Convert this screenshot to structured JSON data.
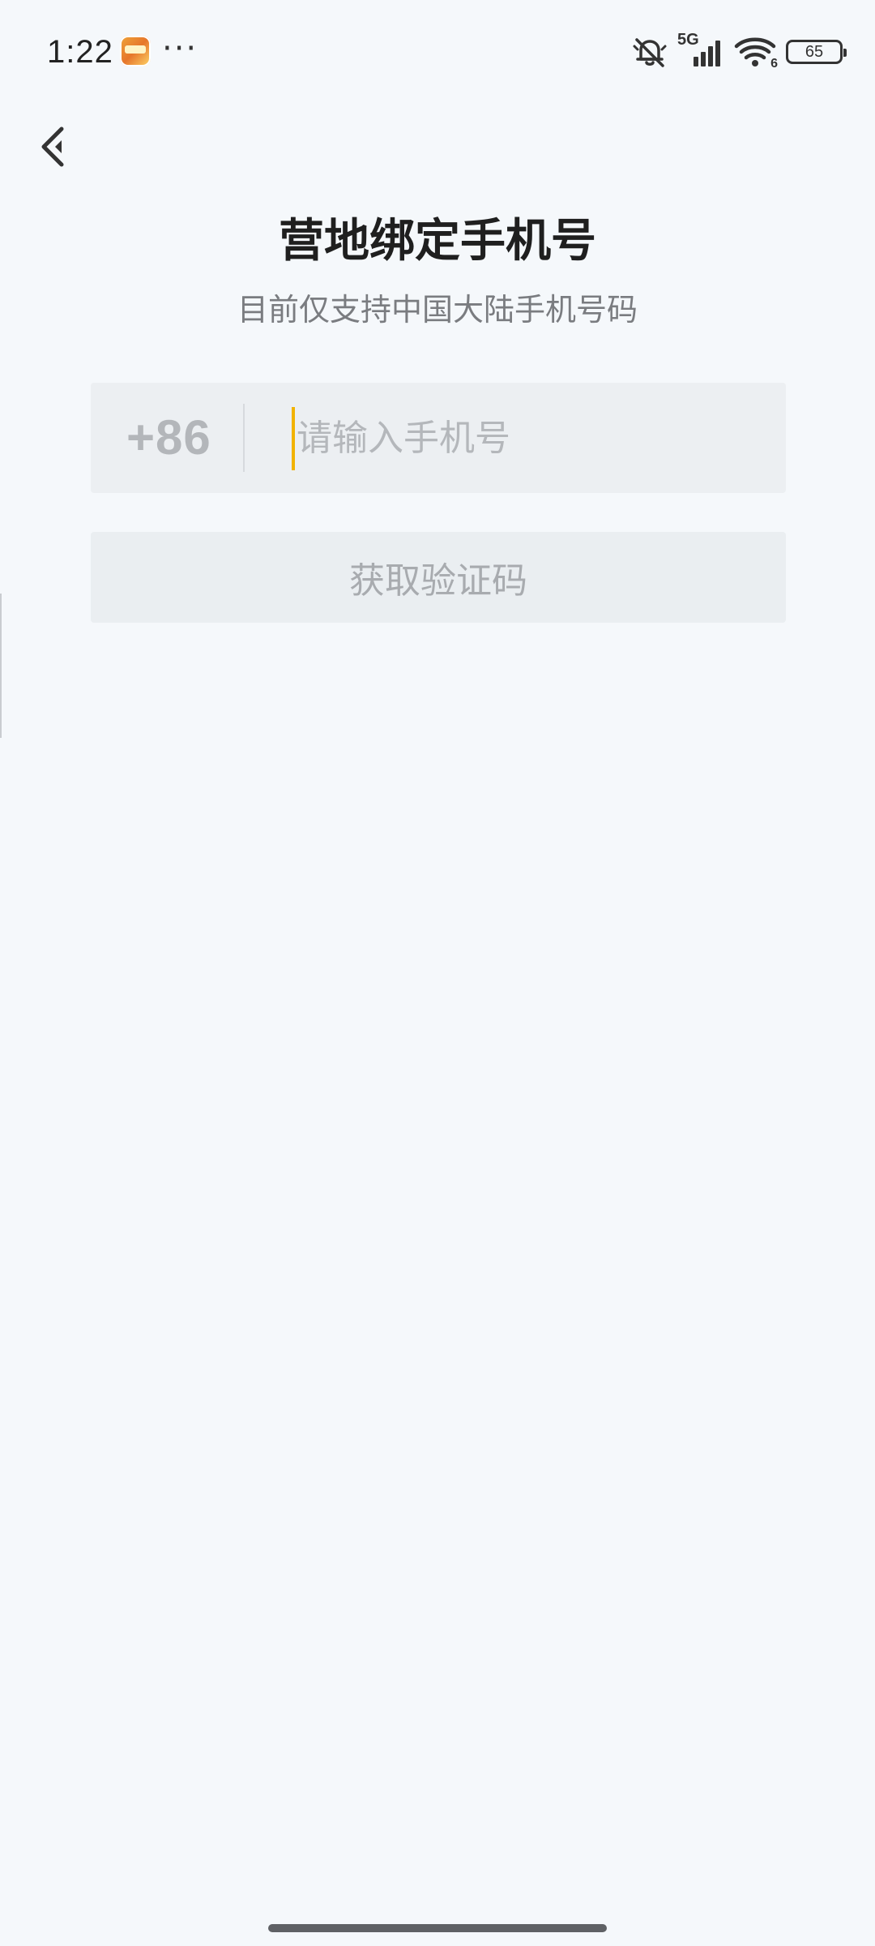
{
  "status_bar": {
    "time": "1:22",
    "more": "···",
    "network": "5G",
    "battery": "65",
    "wifi_sub": "6"
  },
  "header": {
    "title": "营地绑定手机号",
    "subtitle": "目前仅支持中国大陆手机号码"
  },
  "form": {
    "country_code": "+86",
    "phone_value": "",
    "phone_placeholder": "请输入手机号",
    "get_code_label": "获取验证码"
  },
  "colors": {
    "background": "#f5f8fb",
    "field_bg": "#eceff2",
    "caret": "#f2b300",
    "muted_text": "#b4b7bb"
  },
  "icons": {
    "back": "chevron-left-icon",
    "mute": "bell-off-icon",
    "signal": "cellular-signal-icon",
    "wifi": "wifi-icon",
    "battery": "battery-icon"
  }
}
